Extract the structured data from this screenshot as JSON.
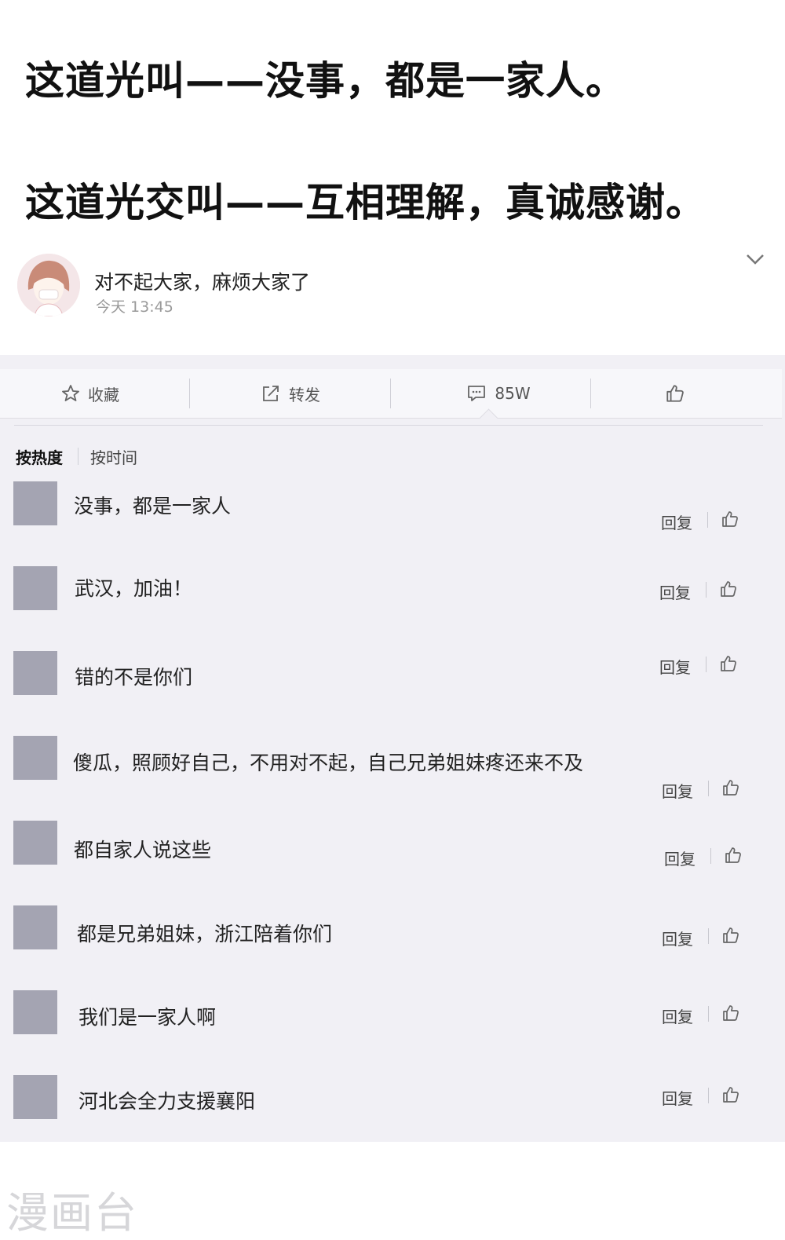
{
  "headline": {
    "line1": "这道光叫——没事，都是一家人。",
    "line2": "这道光交叫——互相理解，真诚感谢。"
  },
  "post": {
    "title": "对不起大家，麻烦大家了",
    "time": "今天 13:45"
  },
  "actions": {
    "favorite_label": "收藏",
    "repost_label": "转发",
    "comment_count": "85W"
  },
  "sort": {
    "by_hot": "按热度",
    "by_time": "按时间"
  },
  "comments": [
    {
      "text": "没事，都是一家人",
      "reply_label": "回复"
    },
    {
      "text": "武汉，加油！",
      "reply_label": "回复"
    },
    {
      "text": "错的不是你们",
      "reply_label": "回复"
    },
    {
      "text": "傻瓜，照顾好自己，不用对不起，自己兄弟姐妹疼还来不及",
      "reply_label": "回复"
    },
    {
      "text": "都自家人说这些",
      "reply_label": "回复"
    },
    {
      "text": "都是兄弟姐妹，浙江陪着你们",
      "reply_label": "回复"
    },
    {
      "text": "我们是一家人啊",
      "reply_label": "回复"
    },
    {
      "text": "河北会全力支援襄阳",
      "reply_label": "回复"
    }
  ],
  "watermark": "漫画台",
  "icons": {
    "favorite": "star-icon",
    "repost": "share-icon",
    "comment": "comment-icon",
    "like": "thumbs-up-icon",
    "expand": "chevron-down-icon"
  },
  "colors": {
    "background": "#ffffff",
    "panel": "#f1f0f5",
    "avatar_placeholder": "#a4a4b2",
    "secondary_text": "#999999"
  }
}
